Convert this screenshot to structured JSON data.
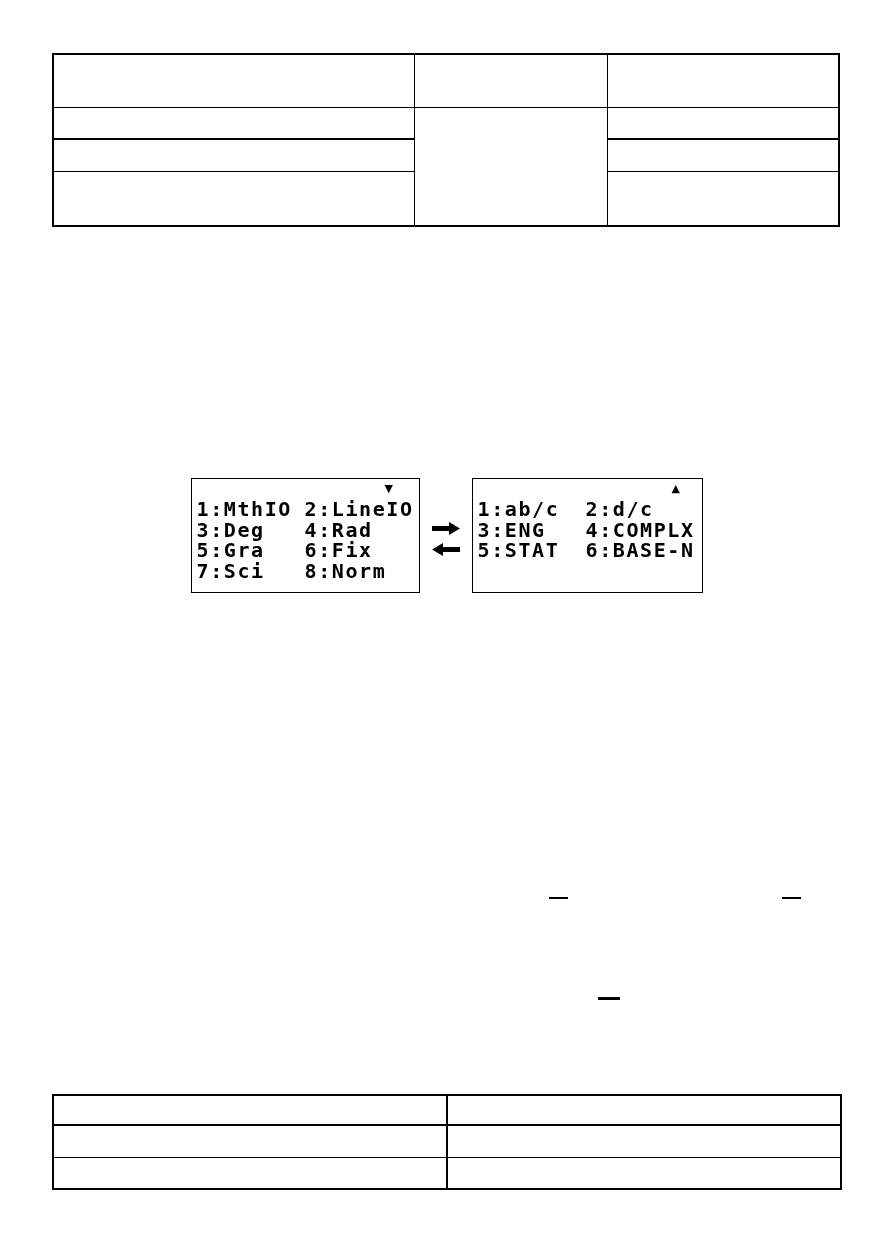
{
  "top_table": {
    "kind": "merged"
  },
  "figure": {
    "screens": [
      {
        "scroll_mark": "▼",
        "items": [
          "1:MthIO",
          "2:LineIO",
          "3:Deg",
          "4:Rad",
          "5:Gra",
          "6:Fix",
          "7:Sci",
          "8:Norm"
        ]
      },
      {
        "scroll_mark": "▲",
        "items": [
          "1:ab/c",
          "2:d/c",
          "3:ENG",
          "4:COMPLX",
          "5:STAT",
          "6:BASE-N"
        ]
      }
    ],
    "arrows": [
      {
        "kind": "right"
      },
      {
        "kind": "left"
      }
    ]
  },
  "overline_marks": [
    {
      "kind": "overline"
    },
    {
      "kind": "overline"
    },
    {
      "kind": "overline"
    }
  ],
  "bottom_table": {
    "kind": "plain"
  }
}
